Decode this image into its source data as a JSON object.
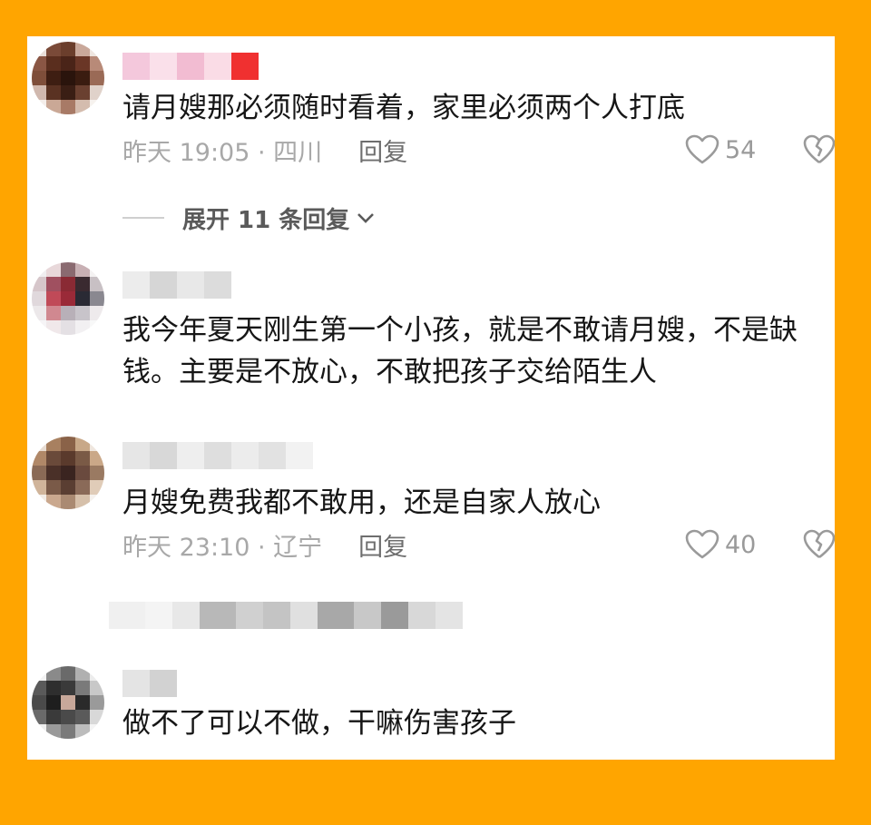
{
  "comments": [
    {
      "text": "请月嫂那必须随时看着，家里必须两个人打底",
      "time_location": "昨天 19:05 · 四川",
      "reply_label": "回复",
      "likes": "54",
      "avatar_colors": [
        "#e8ded8",
        "#7a4a38",
        "#6b3e2c",
        "#c9a89a",
        "#efe6e0",
        "#8a5644",
        "#5a2e1e",
        "#4a2418",
        "#6a3626",
        "#b88a78",
        "#7e4e3a",
        "#3e1e12",
        "#2a140c",
        "#3a1c10",
        "#9a6a56",
        "#d0b8ae",
        "#5a3222",
        "#3a1e14",
        "#6a4030",
        "#e0d2ca",
        "#f4eeea",
        "#caa896",
        "#a87a66",
        "#d4bcae",
        "#f6f2ee"
      ],
      "nick_colors": [
        "#f4c8dc",
        "#fae0ea",
        "#f2bcd2",
        "#fadce6",
        "#f03030"
      ]
    },
    {
      "text": "我今年夏天刚生第一个小孩，就是不敢请月嫂，不是缺钱。主要是不放心，不敢把孩子交给陌生人",
      "avatar_colors": [
        "#f0eef0",
        "#e8d8da",
        "#8a6a70",
        "#c8b0b4",
        "#f4f2f2",
        "#d6c6ca",
        "#a05060",
        "#8a2a34",
        "#3a2a30",
        "#c8c0c4",
        "#e0d8dc",
        "#c04a58",
        "#9a2a38",
        "#2a2a34",
        "#8a8890",
        "#ece8ea",
        "#d08890",
        "#b8b0b8",
        "#c8c4ca",
        "#eeeaec",
        "#f6f4f6",
        "#f0e8ea",
        "#e4e0e4",
        "#f2f0f2",
        "#f8f8f8"
      ],
      "nick_colors": [
        "#ececec",
        "#d6d6d6",
        "#e8e8e8",
        "#dcdcdc"
      ]
    },
    {
      "text": "月嫂免费我都不敢用，还是自家人放心",
      "time_location": "昨天 23:10 · 辽宁",
      "reply_label": "回复",
      "likes": "40",
      "avatar_colors": [
        "#e8dcd2",
        "#a88060",
        "#8a6248",
        "#c8a888",
        "#efe6de",
        "#b08868",
        "#6a4a3a",
        "#5a3a2c",
        "#7a5a46",
        "#caa888",
        "#8a6a56",
        "#4a3028",
        "#3a2420",
        "#6a4a3e",
        "#9a7a62",
        "#d0b49a",
        "#7a5a48",
        "#5a3e32",
        "#8a6a58",
        "#e0ccb8",
        "#f2ebe4",
        "#caa88e",
        "#aa8a72",
        "#d6c0aa",
        "#f6f2ee"
      ],
      "nick_colors": [
        "#e6e6e6",
        "#d8d8d8",
        "#eeeeee",
        "#dedede",
        "#ececec",
        "#e2e2e2",
        "#f2f2f2"
      ]
    },
    {
      "text": "做不了可以不做，干嘛伤害孩子",
      "avatar_colors": [
        "#f2f2f2",
        "#8a8a8a",
        "#6a6a6a",
        "#b0b0b0",
        "#ececec",
        "#5a5a5a",
        "#2e2e2e",
        "#3a3a3a",
        "#7a7a7a",
        "#c8c8c8",
        "#4a4a4a",
        "#1e1e1e",
        "#c8a89a",
        "#2a2a2a",
        "#9a9a9a",
        "#6a6a6a",
        "#3a3a3a",
        "#4a4a4a",
        "#5a5a5a",
        "#d8d8d8",
        "#eeeeee",
        "#9a9a9a",
        "#7a7a7a",
        "#bcbcbc",
        "#f4f4f4"
      ],
      "nick_colors": [
        "#e4e4e4",
        "#d2d2d2"
      ]
    }
  ],
  "expand_label": "展开 11 条回复",
  "blurred_row_colors": [
    "#f0f0f0",
    "#f4f4f4",
    "#e8e8e8",
    "#b8b8b8",
    "#d0d0d0",
    "#c4c4c4",
    "#e0e0e0",
    "#a8a8a8",
    "#c8c8c8",
    "#9a9a9a",
    "#d8d8d8",
    "#e4e4e4"
  ],
  "colors": {
    "background": "#FFA500",
    "panel": "#ffffff",
    "text": "#161616",
    "meta": "#a8a8a8"
  }
}
